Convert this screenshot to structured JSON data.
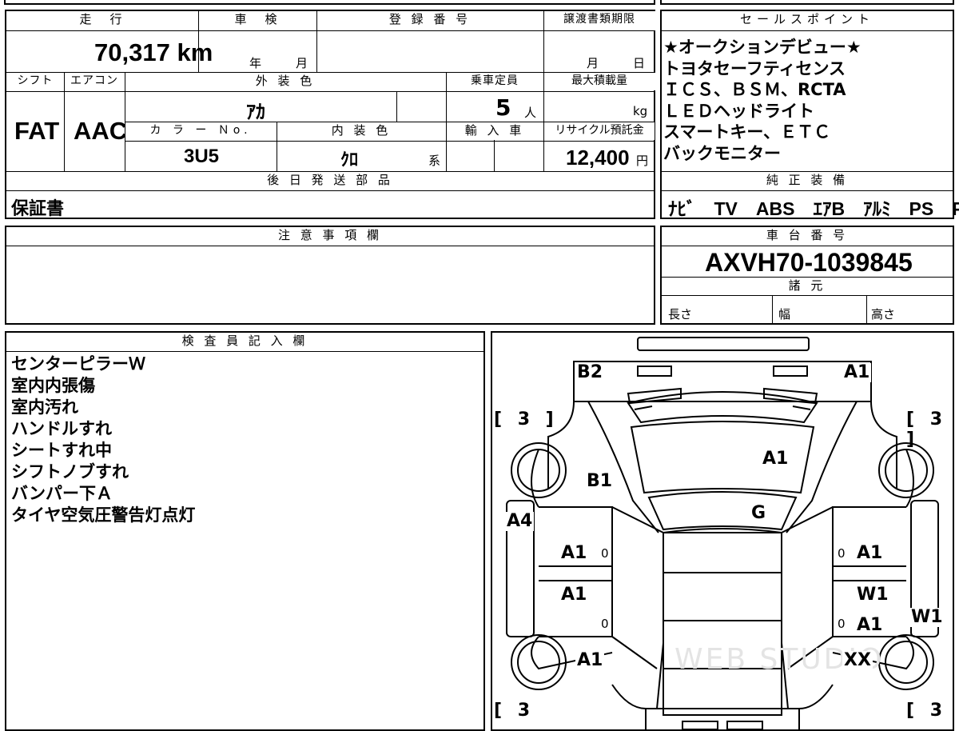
{
  "top": {
    "mileage_header": "走　行",
    "inspection_header": "車　検",
    "registration_header": "登 録 番 号",
    "transfer_header": "譲渡書類期限",
    "mileage_value": "70,317",
    "mileage_unit": "km",
    "inspection_year": "年",
    "inspection_month": "月",
    "transfer_month": "月",
    "transfer_day": "日",
    "shift_header": "シフト",
    "ac_header": "エアコン",
    "exterior_header": "外 装 色",
    "capacity_header": "乗車定員",
    "maxload_header": "最大積載量",
    "shift_value": "FAT",
    "ac_value": "AAC",
    "exterior_value": "ｱｶ",
    "capacity_value": "5",
    "capacity_unit": "人",
    "maxload_unit": "kg",
    "color_no_header": "カ ラ ー Ｎo.",
    "interior_header": "内 装 色",
    "import_header": "輸 入 車",
    "recycle_header": "リサイクル預託金",
    "color_no_value": "3U5",
    "interior_value": "ｸﾛ",
    "interior_suffix": "系",
    "recycle_value": "12,400",
    "recycle_unit": "円",
    "later_parts_header": "後 日 発 送 部 品",
    "later_parts_value": "保証書"
  },
  "sales_points": {
    "header": "セールスポイント",
    "lines": [
      "★オークションデビュー★",
      "トヨタセーフティセンス",
      "ＩＣＳ、ＢＳＭ、RCTA",
      "ＬＥＤヘッドライト",
      "スマートキー、ＥＴＣ",
      "バックモニター"
    ]
  },
  "equipment": {
    "header": "純 正 装 備",
    "value": "ﾅﾋﾞ　TV　ABS　ｴｱB　ｱﾙﾐ　PS　PW"
  },
  "cautions": {
    "header": "注 意 事 項 欄"
  },
  "chassis": {
    "header": "車 台 番 号",
    "value": "AXVH70-1039845",
    "specs_header": "諸 元",
    "length": "長さ",
    "width": "幅",
    "height": "高さ"
  },
  "inspector": {
    "header": "検 査 員 記 入 欄",
    "notes": [
      "センターピラーＷ",
      "室内内張傷",
      "室内汚れ",
      "ハンドルすれ",
      "シートすれ中",
      "シフトノブすれ",
      "バンパー下Ａ",
      "タイヤ空気圧警告灯点灯"
    ]
  },
  "diagram": {
    "tyre_tl": "[ 3 ]",
    "tyre_tr": "[ 3 ]",
    "tyre_bl": "[ 3",
    "tyre_br": "[ 3",
    "rear_left": "B2",
    "rear_right": "A1",
    "trunk": "A1",
    "left_quarter": "B1",
    "rear_glass": "G",
    "left_sill": "A4",
    "left_rear_door": "A1",
    "left_front_door": "A1",
    "left_fender": "A1",
    "right_rear_door": "A1",
    "right_front_door_w": "W1",
    "right_front_door": "A1",
    "right_fender": "XX",
    "right_sill": "W1",
    "zero_mark": "0",
    "watermark": "WEB STUDIO"
  }
}
